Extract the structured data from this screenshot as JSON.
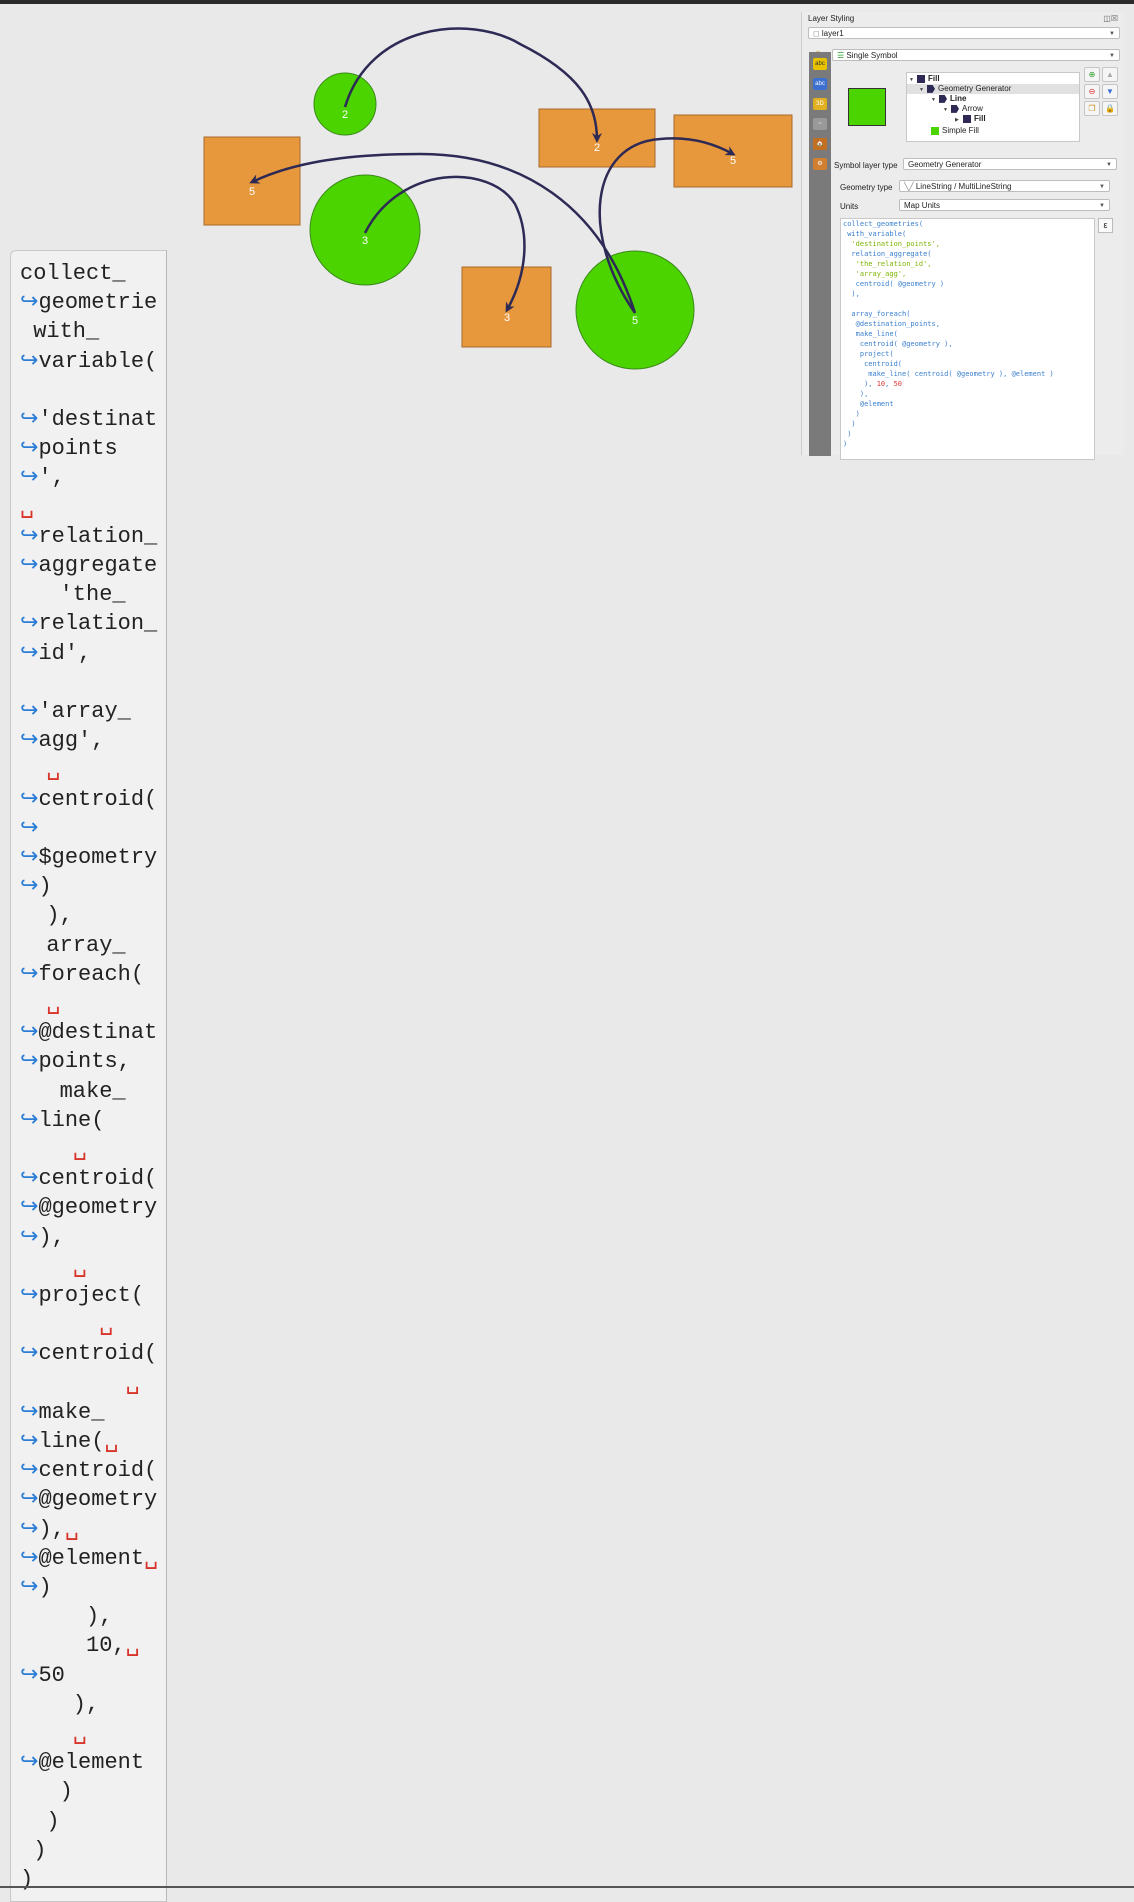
{
  "map": {
    "features": [
      {
        "kind": "circle",
        "label": "2"
      },
      {
        "kind": "circle",
        "label": "3"
      },
      {
        "kind": "circle",
        "label": "5"
      },
      {
        "kind": "rect",
        "label": "5"
      },
      {
        "kind": "rect",
        "label": "2"
      },
      {
        "kind": "rect",
        "label": "5"
      },
      {
        "kind": "rect",
        "label": "3"
      }
    ],
    "colors": {
      "circle_fill": "#4cd400",
      "rect_fill": "#e8983c",
      "arrow": "#2d2a55"
    }
  },
  "code_lines": [
    {
      "t": "collect_",
      "x": 0
    },
    {
      "w": true,
      "t": "geometrie",
      "x": 0
    },
    {
      "t": " with_",
      "x": 0
    },
    {
      "w": true,
      "t": "variable(",
      "x": 0
    },
    {
      "t": "",
      "x": 0
    },
    {
      "w": true,
      "t": "'destinat",
      "x": 0
    },
    {
      "w": true,
      "t": "points",
      "x": 0
    },
    {
      "w": true,
      "t": "',",
      "x": 0
    },
    {
      "sp": true,
      "t": "",
      "x": 0
    },
    {
      "w": true,
      "t": "relation_",
      "x": 0
    },
    {
      "w": true,
      "t": "aggregate",
      "x": 0
    },
    {
      "t": "   'the_",
      "x": 0
    },
    {
      "w": true,
      "t": "relation_",
      "x": 0
    },
    {
      "w": true,
      "t": "id',",
      "x": 0
    },
    {
      "t": "",
      "x": 0
    },
    {
      "w": true,
      "t": "'array_",
      "x": 0
    },
    {
      "w": true,
      "t": "agg',",
      "x": 0
    },
    {
      "sp": true,
      "t": "",
      "x": 1
    },
    {
      "w": true,
      "t": "centroid(",
      "x": 0
    },
    {
      "w": true,
      "t": "",
      "x": 0
    },
    {
      "w": true,
      "t": "$geometry",
      "x": 0
    },
    {
      "w": true,
      "t": ")",
      "x": 0
    },
    {
      "t": "  ),",
      "x": 0
    },
    {
      "t": "  array_",
      "x": 0
    },
    {
      "w": true,
      "t": "foreach(",
      "x": 0
    },
    {
      "sp": true,
      "t": "",
      "x": 1
    },
    {
      "w": true,
      "t": "@destinat",
      "x": 0
    },
    {
      "w": true,
      "t": "points,",
      "x": 0
    },
    {
      "t": "   make_",
      "x": 0
    },
    {
      "w": true,
      "t": "line(",
      "x": 0
    },
    {
      "sp": true,
      "t": "",
      "x": 2
    },
    {
      "w": true,
      "t": "centroid(",
      "x": 0
    },
    {
      "w": true,
      "t": "@geometry",
      "x": 0
    },
    {
      "w": true,
      "t": "),",
      "x": 0
    },
    {
      "sp": true,
      "t": "",
      "x": 2
    },
    {
      "w": true,
      "t": "project(",
      "x": 0
    },
    {
      "sp": true,
      "t": "",
      "x": 3
    },
    {
      "w": true,
      "t": "centroid(",
      "x": 0
    },
    {
      "sp": true,
      "t": "",
      "x": 4
    },
    {
      "w": true,
      "t": "make_",
      "x": 0
    },
    {
      "w": true,
      "t": "line(",
      "x": 0,
      "trail": true
    },
    {
      "w": true,
      "t": "centroid(",
      "x": 0
    },
    {
      "w": true,
      "t": "@geometry",
      "x": 0
    },
    {
      "w": true,
      "t": "),",
      "x": 0,
      "trail": true
    },
    {
      "w": true,
      "t": "@element",
      "x": 0,
      "trail": true
    },
    {
      "w": true,
      "t": ")",
      "x": 0
    },
    {
      "t": "     ),",
      "x": 0
    },
    {
      "t": "     10,",
      "x": 0,
      "trail": true
    },
    {
      "w": true,
      "t": "50",
      "x": 0
    },
    {
      "t": "    ),",
      "x": 0
    },
    {
      "sp": true,
      "t": "",
      "x": 2
    },
    {
      "w": true,
      "t": "@element",
      "x": 0
    },
    {
      "t": "   )",
      "x": 0
    },
    {
      "t": "  )",
      "x": 0
    },
    {
      "t": " )",
      "x": 0
    },
    {
      "t": ")",
      "x": 0
    }
  ],
  "panel": {
    "title": "Layer Styling",
    "title_icons": "◫☒",
    "layer_name": "layer1",
    "renderer": "Single Symbol",
    "tree": [
      "Fill",
      "Geometry Generator",
      "Line",
      "Arrow",
      "Fill",
      "Simple Fill"
    ],
    "symbol_layer_type_label": "Symbol layer type",
    "symbol_layer_type_value": "Geometry Generator",
    "geometry_type_label": "Geometry type",
    "geometry_type_value": "LineString / MultiLineString",
    "units_label": "Units",
    "units_value": "Map Units",
    "expression_button": "ε",
    "side_icons": [
      "abc",
      "abc",
      "3D",
      "~",
      "🏠",
      "⚙"
    ]
  },
  "expr_text": {
    "l1": "collect_geometries(",
    "l2": " with_variable(",
    "l3": "  'destination_points',",
    "l4": "  relation_aggregate(",
    "l5": "   'the_relation_id',",
    "l6": "   'array_agg',",
    "l7": "   centroid( @geometry )",
    "l8": "  ),",
    "l9": "  array_foreach(",
    "l10": "   @destination_points,",
    "l11": "   make_line(",
    "l12": "    centroid( @geometry ),",
    "l13": "    project(",
    "l14": "     centroid(",
    "l15": "      make_line( centroid( @geometry ), @element )",
    "l16": "     ), ",
    "l16b": "10",
    "l16c": ", ",
    "l16d": "50",
    "l17": "    ),",
    "l18": "    @element",
    "l19": "   )",
    "l20": "  )",
    "l21": " )",
    "l22": ")"
  }
}
